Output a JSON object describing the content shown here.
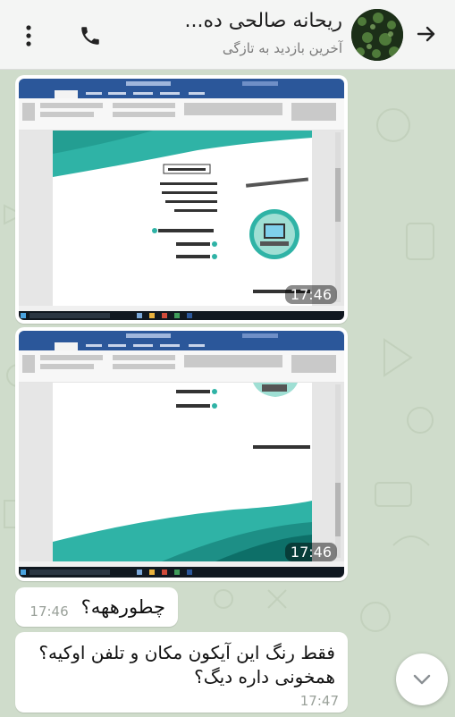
{
  "header": {
    "contact_name": "ریحانه صالحی ده...",
    "status": "آخرین بازدید به تازگی",
    "back_icon": "arrow-right-icon",
    "call_icon": "phone-icon",
    "menu_icon": "more-vertical-icon"
  },
  "messages": [
    {
      "type": "image",
      "time": "17:46",
      "content": "word-document-screenshot-top"
    },
    {
      "type": "image",
      "time": "17:46",
      "content": "word-document-screenshot-bottom"
    },
    {
      "type": "text",
      "text": "چطورههه؟",
      "time": "17:46"
    },
    {
      "type": "text",
      "line1": "فقط رنگ این آیکون مکان و تلفن اوکیه؟",
      "line2": "همخونی داره دیگ؟",
      "time": "17:47"
    }
  ],
  "scroll_down_icon": "chevron-down-icon",
  "colors": {
    "header_bg": "#f4f5f4",
    "chat_bg": "#cfdccb",
    "teal_accent": "#2fb3a6",
    "word_blue": "#2b579a",
    "taskbar": "#101820"
  }
}
